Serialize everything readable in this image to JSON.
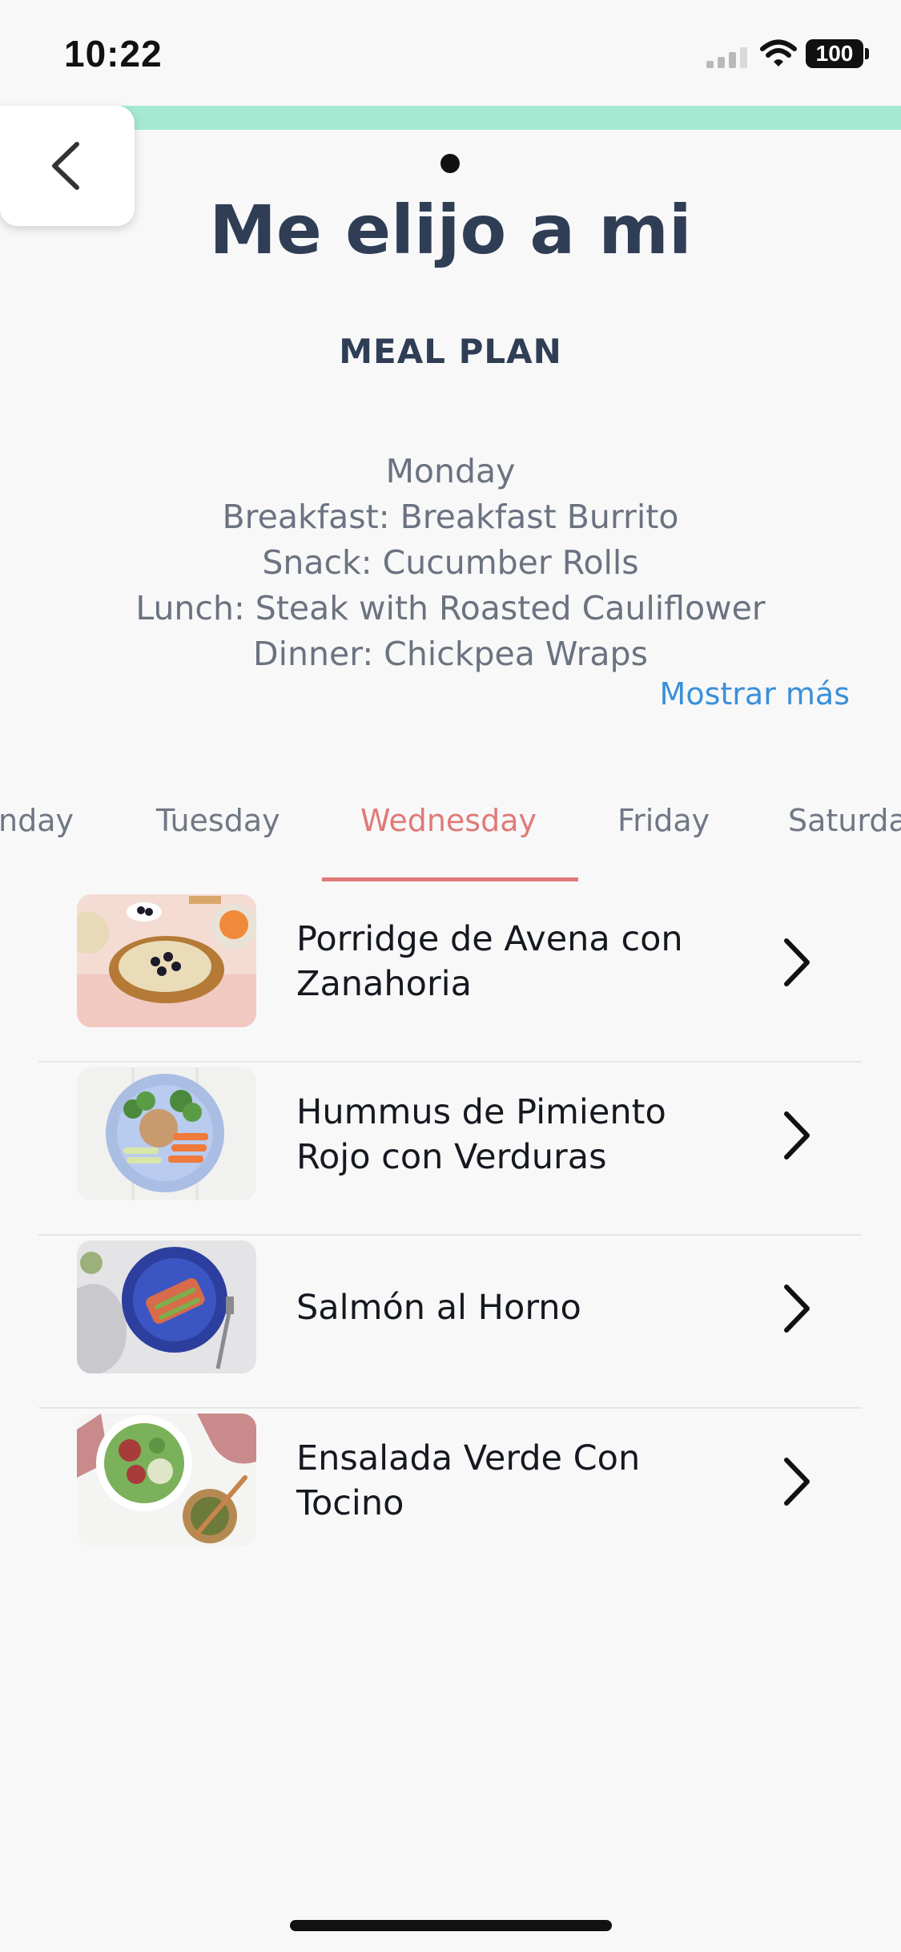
{
  "status_bar": {
    "time": "10:22",
    "battery": "100",
    "icons": [
      "signal-icon",
      "wifi-icon",
      "battery-icon"
    ]
  },
  "header": {
    "back_icon": "chevron-left-icon",
    "title": "Me elijo a mi",
    "section_label": "MEAL PLAN"
  },
  "plan_summary": {
    "lines": [
      "Monday",
      "Breakfast: Breakfast Burrito",
      "Snack: Cucumber Rolls",
      "Lunch: Steak with Roasted Cauliflower",
      "Dinner: Chickpea Wraps"
    ],
    "show_more": "Mostrar más"
  },
  "day_tabs": {
    "items": [
      {
        "label": "nday",
        "active": false
      },
      {
        "label": "Tuesday",
        "active": false
      },
      {
        "label": "Wednesday",
        "active": true
      },
      {
        "label": "Friday",
        "active": false
      },
      {
        "label": "Saturda",
        "active": false
      }
    ]
  },
  "meals": [
    {
      "name": "Porridge de Avena con Zanahoria",
      "icon": "chevron-right-icon"
    },
    {
      "name": "Hummus de Pimiento Rojo con Verduras",
      "icon": "chevron-right-icon"
    },
    {
      "name": "Salmón al Horno",
      "icon": "chevron-right-icon"
    },
    {
      "name": "Ensalada Verde Con Tocino",
      "icon": "chevron-right-icon"
    }
  ],
  "colors": {
    "accent_strip": "#a6e9d3",
    "active_tab": "#e07a78",
    "link": "#3b8fd9",
    "title": "#2f3e55"
  }
}
